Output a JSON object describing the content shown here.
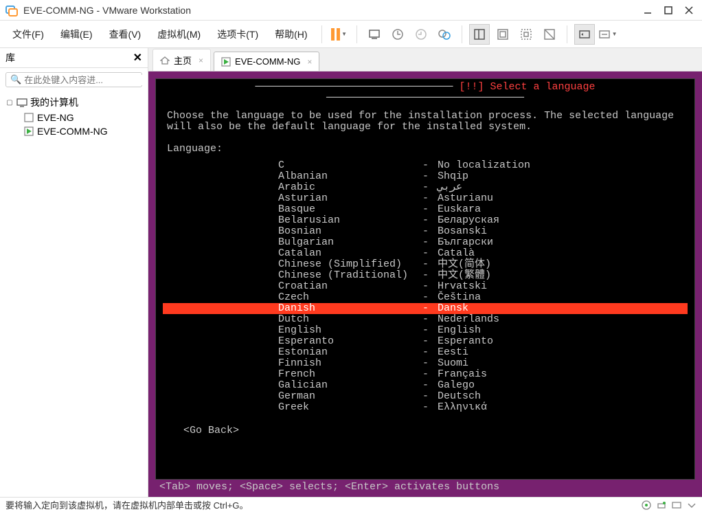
{
  "window": {
    "title": "EVE-COMM-NG - VMware Workstation"
  },
  "menu": {
    "file": "文件(F)",
    "edit": "编辑(E)",
    "view": "查看(V)",
    "vm": "虚拟机(M)",
    "tabs": "选项卡(T)",
    "help": "帮助(H)"
  },
  "sidebar": {
    "title": "库",
    "search_placeholder": "在此处键入内容进...",
    "root": "我的计算机",
    "items": [
      "EVE-NG",
      "EVE-COMM-NG"
    ]
  },
  "tabs": {
    "home": "主页",
    "vm": "EVE-COMM-NG"
  },
  "installer": {
    "title": "[!!] Select a language",
    "description": "Choose the language to be used for the installation process. The selected language will also be the default language for the installed system.",
    "prompt": "Language:",
    "goback": "<Go Back>",
    "hint": "<Tab> moves; <Space> selects; <Enter> activates buttons",
    "selected_index": 14,
    "languages": [
      {
        "name": "C",
        "native": "No localization"
      },
      {
        "name": "Albanian",
        "native": "Shqip"
      },
      {
        "name": "Arabic",
        "native": "عربي"
      },
      {
        "name": "Asturian",
        "native": "Asturianu"
      },
      {
        "name": "Basque",
        "native": "Euskara"
      },
      {
        "name": "Belarusian",
        "native": "Беларуская"
      },
      {
        "name": "Bosnian",
        "native": "Bosanski"
      },
      {
        "name": "Bulgarian",
        "native": "Български"
      },
      {
        "name": "Catalan",
        "native": "Català"
      },
      {
        "name": "Chinese (Simplified)",
        "native": "中文(简体)"
      },
      {
        "name": "Chinese (Traditional)",
        "native": "中文(繁體)"
      },
      {
        "name": "Croatian",
        "native": "Hrvatski"
      },
      {
        "name": "Czech",
        "native": "Čeština"
      },
      {
        "name": "Danish",
        "native": "Dansk"
      },
      {
        "name": "Dutch",
        "native": "Nederlands"
      },
      {
        "name": "English",
        "native": "English"
      },
      {
        "name": "Esperanto",
        "native": "Esperanto"
      },
      {
        "name": "Estonian",
        "native": "Eesti"
      },
      {
        "name": "Finnish",
        "native": "Suomi"
      },
      {
        "name": "French",
        "native": "Français"
      },
      {
        "name": "Galician",
        "native": "Galego"
      },
      {
        "name": "German",
        "native": "Deutsch"
      },
      {
        "name": "Greek",
        "native": "Ελληνικά"
      }
    ]
  },
  "statusbar": {
    "text": "要将输入定向到该虚拟机，请在虚拟机内部单击或按 Ctrl+G。"
  }
}
